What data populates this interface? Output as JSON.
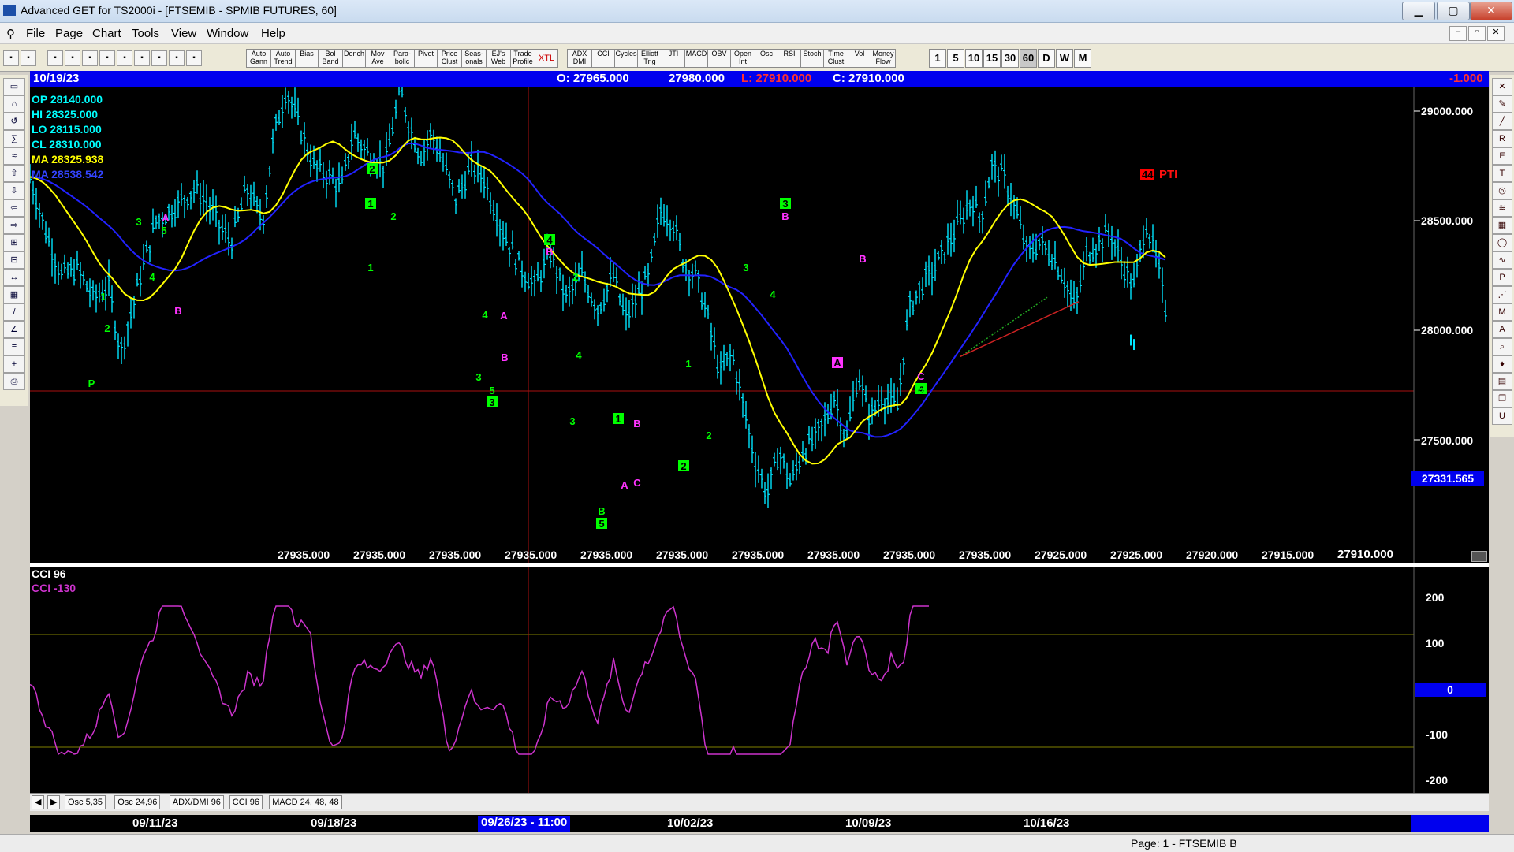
{
  "window": {
    "title": "Advanced GET for TS2000i - [FTSEMIB - SPMIB FUTURES, 60]",
    "minimize": "▁",
    "maximize": "▢",
    "close": "✕"
  },
  "menu": [
    "File",
    "Page",
    "Chart",
    "Tools",
    "View",
    "Window",
    "Help"
  ],
  "toolbar": {
    "studies": [
      "Auto Gann",
      "Auto Trend",
      "Bias",
      "Bol Band",
      "Donch",
      "Mov Ave",
      "Para-bolic",
      "Pivot",
      "Price Clust",
      "Seas-onals",
      "EJ's Web",
      "Trade Profile",
      "XTL",
      "ADX DMI",
      "CCI",
      "Cycles",
      "Elliott Trig",
      "JTI",
      "MACD",
      "OBV",
      "Open Int",
      "Osc",
      "RSI",
      "Stoch",
      "Time Clust",
      "Vol",
      "Money Flow"
    ],
    "timeframes": [
      "1",
      "5",
      "10",
      "15",
      "30",
      "60",
      "D",
      "W",
      "M"
    ],
    "selected_timeframe": "60"
  },
  "infobar": {
    "date": "10/19/23",
    "open": "O: 27965.000",
    "high": "27980.000",
    "low": "L:  27910.000",
    "close": "C:  27910.000",
    "change": "-1.000"
  },
  "legend": {
    "op": "OP  28140.000",
    "hi": "HI   28325.000",
    "lo": "LO  28115.000",
    "cl": "CL  28310.000",
    "ma1": "MA  28325.938",
    "ma2": "MA  28538.542"
  },
  "price_axis": [
    "29000.000",
    "28500.000",
    "28000.000",
    "27500.000"
  ],
  "cursor_price": "27331.565",
  "bottom_values": [
    "27935.000",
    "27935.000",
    "27935.000",
    "27935.000",
    "27935.000",
    "27935.000",
    "27935.000",
    "27935.000",
    "27935.000",
    "27935.000",
    "27925.000",
    "27925.000",
    "27920.000",
    "27915.000"
  ],
  "last_value": "27910.000",
  "pti": {
    "value": "44",
    "label": "PTI"
  },
  "cci": {
    "title": "CCI 96",
    "value_label": "CCI  -130",
    "axis": [
      "200",
      "100",
      "0",
      "-100",
      "-200"
    ],
    "zero_label": "0"
  },
  "tabs": [
    "Osc 5,35",
    "Osc 24,96",
    "ADX/DMI 96",
    "CCI 96",
    "MACD 24, 48, 48"
  ],
  "dates": [
    "09/11/23",
    "09/18/23",
    "09/26/23 - 11:00",
    "10/02/23",
    "10/09/23",
    "10/16/23"
  ],
  "status": "Page: 1 - FTSEMIB B",
  "colors": {
    "bars": "#00e5ff",
    "ma_fast": "#ffff00",
    "ma_slow": "#2222ff",
    "cci": "#cc33cc",
    "green_label": "#00ff00",
    "magenta_label": "#ff33ff",
    "infobar": "#0000ee"
  },
  "wave_labels": [
    {
      "t": "P",
      "c": "g"
    },
    {
      "t": "1",
      "c": "g"
    },
    {
      "t": "2",
      "c": "g"
    },
    {
      "t": "3",
      "c": "g"
    },
    {
      "t": "4",
      "c": "g"
    },
    {
      "t": "5",
      "c": "g"
    },
    {
      "t": "A",
      "c": "m"
    },
    {
      "t": "B",
      "c": "m"
    },
    {
      "t": "2",
      "c": "gb"
    },
    {
      "t": "1",
      "c": "gb"
    },
    {
      "t": "2",
      "c": "g"
    },
    {
      "t": "1",
      "c": "g"
    },
    {
      "t": "4",
      "c": "gb"
    },
    {
      "t": "B",
      "c": "m"
    },
    {
      "t": "2",
      "c": "g"
    },
    {
      "t": "A",
      "c": "m"
    },
    {
      "t": "4",
      "c": "g"
    },
    {
      "t": "B",
      "c": "m"
    },
    {
      "t": "3",
      "c": "g"
    },
    {
      "t": "5",
      "c": "g"
    },
    {
      "t": "3",
      "c": "gb"
    },
    {
      "t": "4",
      "c": "g"
    },
    {
      "t": "3",
      "c": "g"
    },
    {
      "t": "1",
      "c": "gb"
    },
    {
      "t": "B",
      "c": "m"
    },
    {
      "t": "A",
      "c": "m"
    },
    {
      "t": "C",
      "c": "m"
    },
    {
      "t": "B",
      "c": "g"
    },
    {
      "t": "5",
      "c": "gb"
    },
    {
      "t": "1",
      "c": "g"
    },
    {
      "t": "2",
      "c": "gb"
    },
    {
      "t": "2",
      "c": "g"
    },
    {
      "t": "3",
      "c": "g"
    },
    {
      "t": "4",
      "c": "g"
    },
    {
      "t": "3",
      "c": "gb"
    },
    {
      "t": "B",
      "c": "m"
    },
    {
      "t": "B",
      "c": "m"
    },
    {
      "t": "A",
      "c": "m"
    },
    {
      "t": "C",
      "c": "m"
    },
    {
      "t": "4",
      "c": "gb"
    },
    {
      "t": "5",
      "c": "g"
    },
    {
      "t": "B",
      "c": "m"
    },
    {
      "t": "A",
      "c": "mb"
    }
  ]
}
